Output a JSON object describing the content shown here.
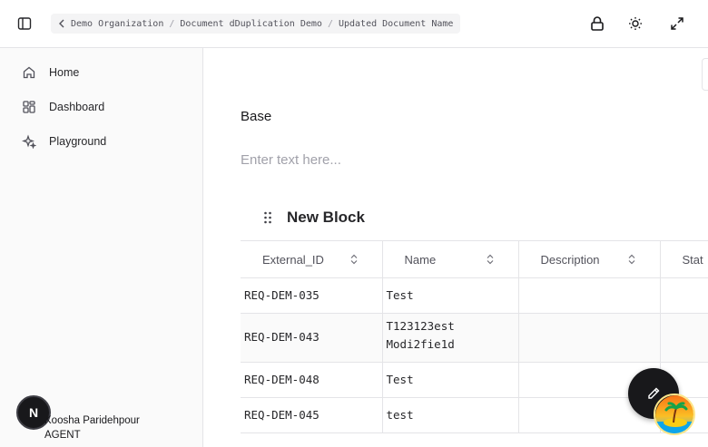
{
  "breadcrumb": {
    "items": [
      "Demo Organization",
      "Document dDuplication Demo",
      "Updated Document Name"
    ],
    "separator": "/"
  },
  "sidebar": {
    "items": [
      {
        "label": "Home",
        "icon": "home-icon"
      },
      {
        "label": "Dashboard",
        "icon": "dashboard-icon"
      },
      {
        "label": "Playground",
        "icon": "sparkles-icon"
      }
    ],
    "user": {
      "initial": "N",
      "name": "Koosha Paridehpour",
      "role": "AGENT"
    }
  },
  "main": {
    "base_label": "Base",
    "text_placeholder": "Enter text here...",
    "block_title": "New Block",
    "table": {
      "columns": [
        "External_ID",
        "Name",
        "Description",
        "Stat"
      ],
      "rows": [
        {
          "id": "REQ-DEM-035",
          "name": "Test",
          "description": ""
        },
        {
          "id": "REQ-DEM-043",
          "name": "T123123est Modi2fie1d",
          "description": ""
        },
        {
          "id": "REQ-DEM-048",
          "name": "Test",
          "description": ""
        },
        {
          "id": "REQ-DEM-045",
          "name": "test",
          "description": ""
        }
      ]
    }
  },
  "colors": {
    "accent": "#18181b",
    "border": "#e4e4e7",
    "sidebar_bg": "#fafafa"
  }
}
